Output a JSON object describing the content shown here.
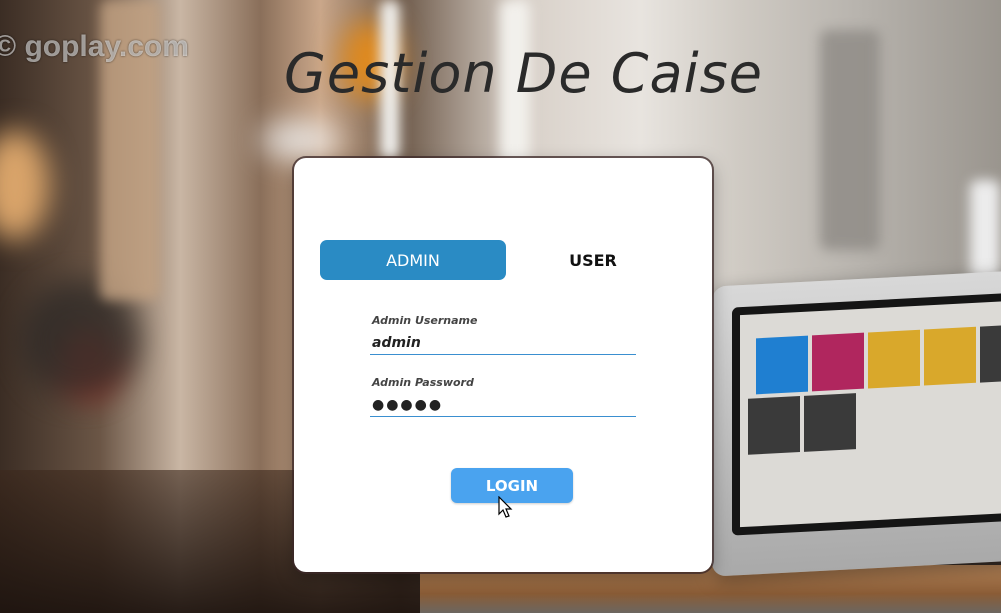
{
  "background": {
    "watermark_text": "goplay.com",
    "app_title": "Gestion De Caise"
  },
  "login_card": {
    "tabs": [
      {
        "label": "ADMIN",
        "active": true
      },
      {
        "label": "USER",
        "active": false
      }
    ],
    "username": {
      "label": "Admin Username",
      "value": "admin"
    },
    "password": {
      "label": "Admin Password",
      "value": "●●●●●"
    },
    "login_label": "LOGIN"
  },
  "colors": {
    "active_tab": "#2a8bc4",
    "login_button": "#4aa3ef",
    "input_underline": "#3a8fd0"
  },
  "icons": [
    "mouse-cursor-icon"
  ]
}
